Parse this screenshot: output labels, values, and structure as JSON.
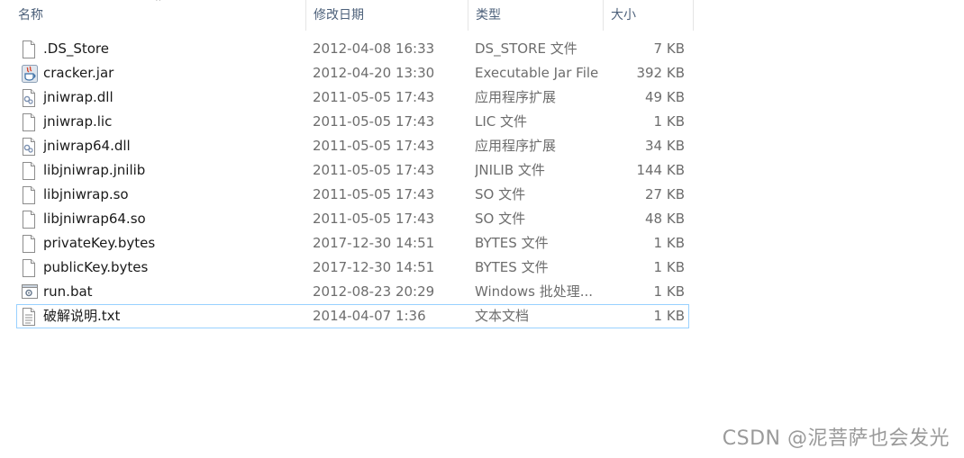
{
  "columns": {
    "name": "名称",
    "date": "修改日期",
    "type": "类型",
    "size": "大小"
  },
  "files": [
    {
      "name": ".DS_Store",
      "date": "2012-04-08 16:33",
      "type": "DS_STORE 文件",
      "size": "7 KB",
      "icon": "blank-file-icon"
    },
    {
      "name": "cracker.jar",
      "date": "2012-04-20 13:30",
      "type": "Executable Jar File",
      "size": "392 KB",
      "icon": "java-jar-icon"
    },
    {
      "name": "jniwrap.dll",
      "date": "2011-05-05 17:43",
      "type": "应用程序扩展",
      "size": "49 KB",
      "icon": "dll-file-icon"
    },
    {
      "name": "jniwrap.lic",
      "date": "2011-05-05 17:43",
      "type": "LIC 文件",
      "size": "1 KB",
      "icon": "blank-file-icon"
    },
    {
      "name": "jniwrap64.dll",
      "date": "2011-05-05 17:43",
      "type": "应用程序扩展",
      "size": "34 KB",
      "icon": "dll-file-icon"
    },
    {
      "name": "libjniwrap.jnilib",
      "date": "2011-05-05 17:43",
      "type": "JNILIB 文件",
      "size": "144 KB",
      "icon": "blank-file-icon"
    },
    {
      "name": "libjniwrap.so",
      "date": "2011-05-05 17:43",
      "type": "SO 文件",
      "size": "27 KB",
      "icon": "blank-file-icon"
    },
    {
      "name": "libjniwrap64.so",
      "date": "2011-05-05 17:43",
      "type": "SO 文件",
      "size": "48 KB",
      "icon": "blank-file-icon"
    },
    {
      "name": "privateKey.bytes",
      "date": "2017-12-30 14:51",
      "type": "BYTES 文件",
      "size": "1 KB",
      "icon": "blank-file-icon"
    },
    {
      "name": "publicKey.bytes",
      "date": "2017-12-30 14:51",
      "type": "BYTES 文件",
      "size": "1 KB",
      "icon": "blank-file-icon"
    },
    {
      "name": "run.bat",
      "date": "2012-08-23 20:29",
      "type": "Windows 批处理...",
      "size": "1 KB",
      "icon": "batch-file-icon"
    },
    {
      "name": "破解说明.txt",
      "date": "2014-04-07 1:36",
      "type": "文本文档",
      "size": "1 KB",
      "icon": "text-file-icon"
    }
  ],
  "selected_index": 11,
  "watermark": "CSDN @泥菩萨也会发光",
  "colors": {
    "header_text": "#4c607a",
    "selection_border": "#99d1ff",
    "secondary_text": "#6d6d6d"
  }
}
